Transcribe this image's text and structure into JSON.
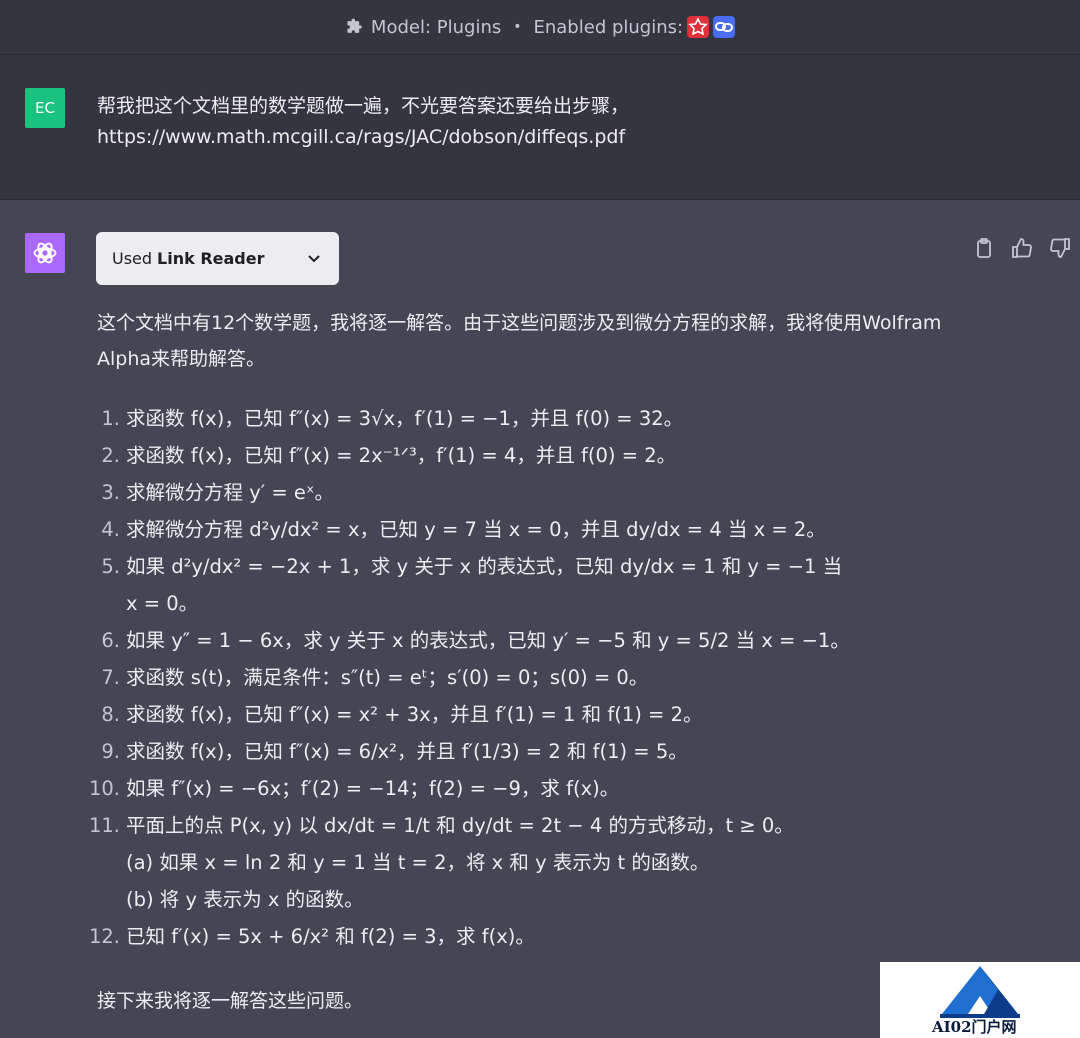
{
  "topbar": {
    "model_label": "Model: Plugins",
    "separator": "•",
    "enabled_label": "Enabled plugins:",
    "plugin_colors": [
      "#e0303a",
      "#4a6cf0"
    ]
  },
  "user": {
    "avatar": "EC",
    "line1": "帮我把这个文档里的数学题做一遍，不光要答案还要给出步骤，",
    "line2": "https://www.math.mcgill.ca/rags/JAC/dobson/diffeqs.pdf"
  },
  "assistant": {
    "plugin_used_prefix": "Used",
    "plugin_used_name": "Link Reader",
    "intro": "这个文档中有12个数学题，我将逐一解答。由于这些问题涉及到微分方程的求解，我将使用Wolfram Alpha来帮助解答。",
    "questions": [
      {
        "num": "1.",
        "text": "求函数 f(x)，已知 f″(x) = 3√x，f′(1) = −1，并且 f(0) = 32。"
      },
      {
        "num": "2.",
        "text": "求函数 f(x)，已知 f″(x) = 2x⁻¹ᐟ³，f′(1) = 4，并且 f(0) = 2。"
      },
      {
        "num": "3.",
        "text": "求解微分方程 y′ = eˣ。"
      },
      {
        "num": "4.",
        "text": "求解微分方程 d²y/dx² = x，已知 y = 7 当 x = 0，并且 dy/dx = 4 当 x = 2。"
      },
      {
        "num": "5.",
        "text": "如果 d²y/dx² = −2x + 1，求 y 关于 x 的表达式，已知 dy/dx = 1 和 y = −1 当"
      },
      {
        "num": "",
        "text": "x = 0。"
      },
      {
        "num": "6.",
        "text": "如果 y″ = 1 − 6x，求 y 关于 x 的表达式，已知 y′ = −5 和 y = 5/2 当 x = −1。"
      },
      {
        "num": "7.",
        "text": "求函数 s(t)，满足条件：s″(t) = eᵗ；s′(0) = 0；s(0) = 0。"
      },
      {
        "num": "8.",
        "text": "求函数 f(x)，已知 f″(x) = x² + 3x，并且 f′(1) = 1 和 f(1) = 2。"
      },
      {
        "num": "9.",
        "text": "求函数 f(x)，已知 f″(x) = 6/x²，并且 f′(1/3) = 2 和 f(1) = 5。"
      },
      {
        "num": "10.",
        "text": "如果 f″(x) = −6x；f′(2) = −14；f(2) = −9，求 f(x)。"
      },
      {
        "num": "11.",
        "text": "平面上的点 P(x, y) 以 dx/dt = 1/t 和 dy/dt = 2t − 4 的方式移动，t ≥ 0。"
      },
      {
        "num": "",
        "text": "(a) 如果 x = ln 2 和 y = 1 当 t = 2，将 x 和 y 表示为 t 的函数。"
      },
      {
        "num": "",
        "text": "(b) 将 y 表示为 x 的函数。"
      },
      {
        "num": "12.",
        "text": "已知 f′(x) = 5x + 6/x² 和 f(2) = 3，求 f(x)。"
      }
    ],
    "outro": "接下来我将逐一解答这些问题。"
  },
  "watermark": {
    "text": "AI02门户网"
  }
}
